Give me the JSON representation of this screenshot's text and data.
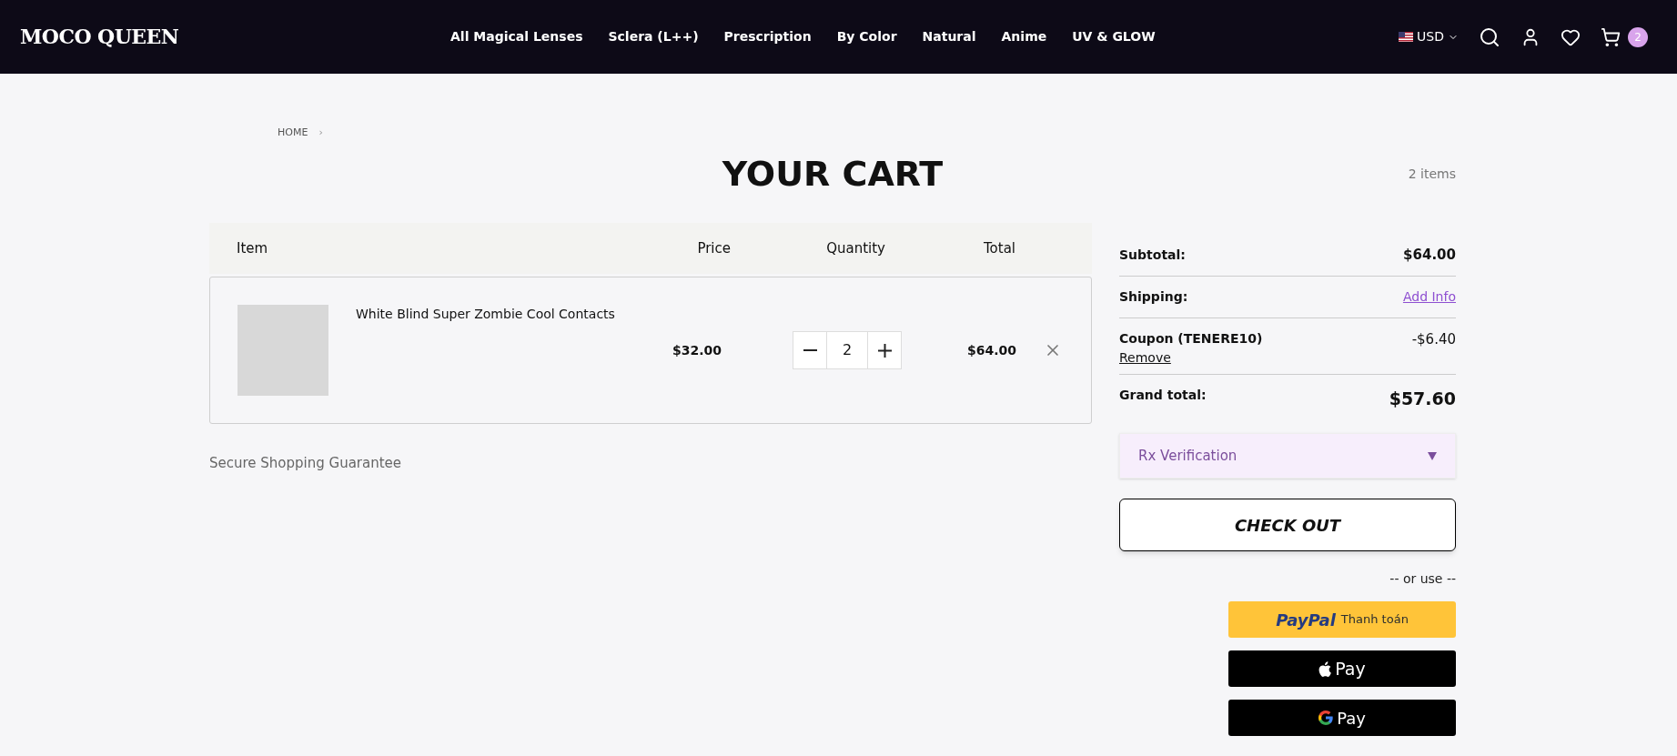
{
  "header": {
    "logo": "MOCO QUEEN",
    "nav": [
      "All Magical Lenses",
      "Sclera (L++)",
      "Prescription",
      "By Color",
      "Natural",
      "Anime",
      "UV & GLOW"
    ],
    "currency": "USD",
    "cart_count": "2"
  },
  "breadcrumb": {
    "items": [
      "HOME"
    ],
    "separator": "›"
  },
  "page_title": "YOUR CART",
  "item_count": "2 items",
  "table": {
    "columns": [
      "Item",
      "Price",
      "Quantity",
      "Total"
    ],
    "rows": [
      {
        "name": "White Blind Super Zombie Cool Contacts",
        "price": "$32.00",
        "quantity": "2",
        "total": "$64.00"
      }
    ]
  },
  "guarantee": "Secure Shopping Guarantee",
  "summary": {
    "subtotal_label": "Subtotal:",
    "subtotal": "$64.00",
    "shipping_label": "Shipping:",
    "shipping_link": "Add Info",
    "coupon_label": "Coupon (TENERE10)",
    "coupon_remove": "Remove",
    "coupon_value": "-$6.40",
    "grand_total_label": "Grand total:",
    "grand_total": "$57.60"
  },
  "rx": {
    "label": "Rx Verification",
    "expanded": false
  },
  "checkout": "CHECK OUT",
  "or_use": "-- or use --",
  "payments": [
    {
      "kind": "paypal",
      "brand": "PayPal",
      "label": "Thanh toán"
    },
    {
      "kind": "apple",
      "label": "Pay"
    },
    {
      "kind": "google",
      "label": "Pay"
    }
  ]
}
